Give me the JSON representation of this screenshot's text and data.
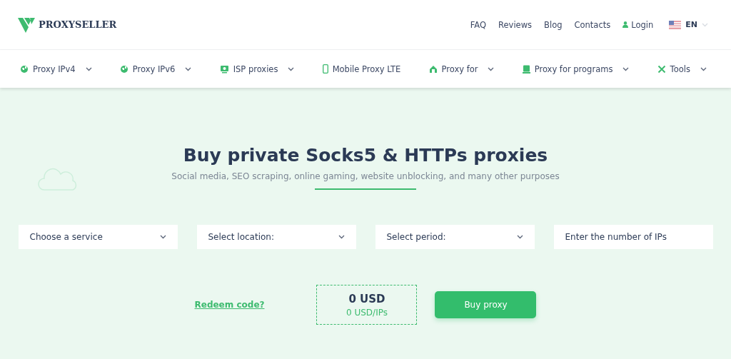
{
  "logo": {
    "text": "PROXYSELLER"
  },
  "top_links": [
    {
      "label": "FAQ",
      "kind": "link"
    },
    {
      "label": "Reviews",
      "kind": "link"
    },
    {
      "label": "Blog",
      "kind": "link"
    },
    {
      "label": "Contacts",
      "kind": "link"
    },
    {
      "label": "Login",
      "kind": "login"
    }
  ],
  "language": {
    "label": "EN"
  },
  "nav": [
    {
      "label": "Proxy IPv4",
      "dropdown": true
    },
    {
      "label": "Proxy IPv6",
      "dropdown": true
    },
    {
      "label": "ISP proxies",
      "dropdown": true
    },
    {
      "label": "Mobile Proxy LTE",
      "dropdown": false
    },
    {
      "label": "Proxy for",
      "dropdown": true
    },
    {
      "label": "Proxy for programs",
      "dropdown": true
    },
    {
      "label": "Tools",
      "dropdown": true
    }
  ],
  "hero": {
    "title": "Buy private Socks5 & HTTPs proxies",
    "subtitle": "Social media, SEO scraping, online gaming, website unblocking, and many other purposes"
  },
  "form": [
    {
      "kind": "select",
      "placeholder": "Choose a service"
    },
    {
      "kind": "select",
      "placeholder": "Select location:"
    },
    {
      "kind": "select",
      "placeholder": "Select period:"
    },
    {
      "kind": "input",
      "placeholder": "Enter the number of IPs"
    }
  ],
  "redeem": "Redeem code?",
  "price": {
    "total": "0 USD",
    "per_ip": "0 USD/IPs"
  },
  "buy_button": "Buy proxy"
}
